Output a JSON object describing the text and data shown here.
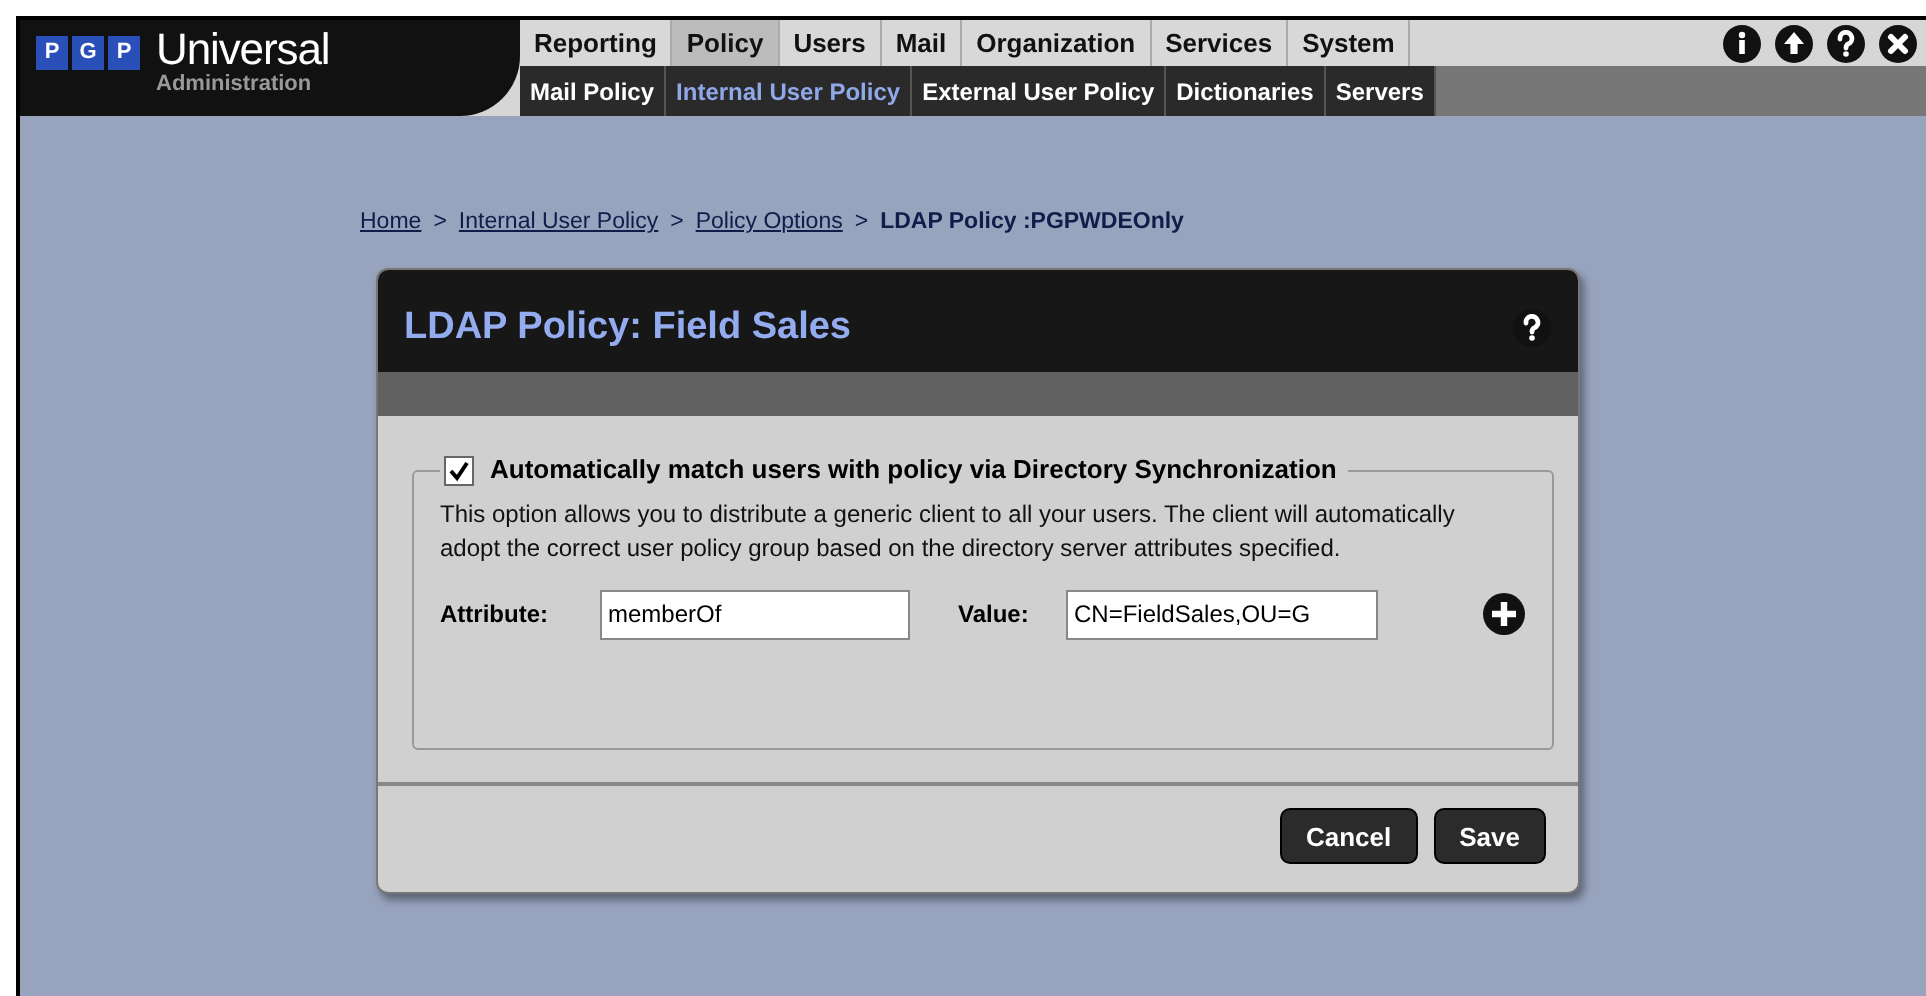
{
  "logo": {
    "letters": [
      "P",
      "G",
      "P"
    ],
    "title": "Universal",
    "subtitle": "Administration"
  },
  "tabs": [
    {
      "label": "Reporting",
      "selected": false
    },
    {
      "label": "Policy",
      "selected": true
    },
    {
      "label": "Users",
      "selected": false
    },
    {
      "label": "Mail",
      "selected": false
    },
    {
      "label": "Organization",
      "selected": false
    },
    {
      "label": "Services",
      "selected": false
    },
    {
      "label": "System",
      "selected": false
    }
  ],
  "subtabs": [
    {
      "label": "Mail Policy",
      "selected": false
    },
    {
      "label": "Internal User Policy",
      "selected": true
    },
    {
      "label": "External User Policy",
      "selected": false
    },
    {
      "label": "Dictionaries",
      "selected": false
    },
    {
      "label": "Servers",
      "selected": false
    }
  ],
  "toolbar_icons": [
    {
      "kind": "info"
    },
    {
      "kind": "up"
    },
    {
      "kind": "help"
    },
    {
      "kind": "close"
    }
  ],
  "breadcrumb": {
    "links": [
      "Home",
      "Internal User Policy",
      "Policy Options"
    ],
    "separator": ">",
    "current": "LDAP Policy :PGPWDEOnly"
  },
  "dialog": {
    "title": "LDAP Policy: Field Sales",
    "section": {
      "checkbox_label": "Automatically match users with policy via Directory Synchronization",
      "checked": true,
      "description": "This option allows you to distribute a generic client to all your users. The client will automatically adopt the correct user policy group based on the directory server attributes specified.",
      "attribute_label": "Attribute:",
      "attribute_value": "memberOf",
      "value_label": "Value:",
      "value_value": "CN=FieldSales,OU=G"
    },
    "buttons": [
      "Cancel",
      "Save"
    ]
  }
}
